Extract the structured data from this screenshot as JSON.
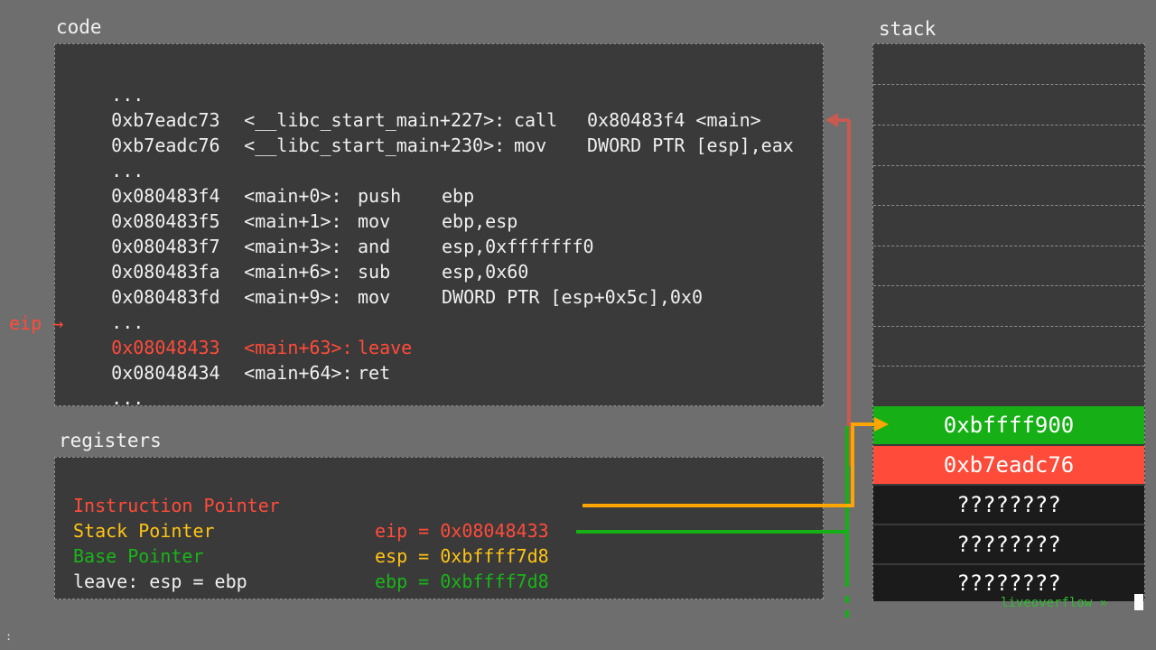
{
  "code": {
    "label": "code",
    "lines": [
      {
        "addr": "...",
        "sym": "",
        "op": "",
        "arg": ""
      },
      {
        "addr": "0xb7eadc73",
        "sym": "<__libc_start_main+227>:",
        "op": "call",
        "arg": "0x80483f4 <main>"
      },
      {
        "addr": "0xb7eadc76",
        "sym": "<__libc_start_main+230>:",
        "op": "mov",
        "arg": "DWORD PTR [esp],eax"
      },
      {
        "addr": "...",
        "sym": "",
        "op": "",
        "arg": ""
      },
      {
        "addr": "0x080483f4",
        "sym": "<main+0>:",
        "op": "push",
        "arg": "ebp"
      },
      {
        "addr": "0x080483f5",
        "sym": "<main+1>:",
        "op": "mov",
        "arg": "ebp,esp"
      },
      {
        "addr": "0x080483f7",
        "sym": "<main+3>:",
        "op": "and",
        "arg": "esp,0xfffffff0"
      },
      {
        "addr": "0x080483fa",
        "sym": "<main+6>:",
        "op": "sub",
        "arg": "esp,0x60"
      },
      {
        "addr": "0x080483fd",
        "sym": "<main+9>:",
        "op": "mov",
        "arg": "DWORD PTR [esp+0x5c],0x0"
      },
      {
        "addr": "...",
        "sym": "",
        "op": "",
        "arg": ""
      },
      {
        "addr": "0x08048433",
        "sym": "<main+63>:",
        "op": "leave",
        "arg": ""
      },
      {
        "addr": "0x08048434",
        "sym": "<main+64>:",
        "op": "ret",
        "arg": ""
      },
      {
        "addr": "...",
        "sym": "",
        "op": "",
        "arg": ""
      }
    ],
    "eip_marker": "eip →"
  },
  "registers": {
    "label": "registers",
    "eip": {
      "name": "Instruction Pointer",
      "value": "eip = 0x08048433"
    },
    "esp": {
      "name": "Stack Pointer",
      "value": "esp = 0xbffff7d8"
    },
    "ebp": {
      "name": "Base Pointer",
      "value": "ebp = 0xbffff7d8"
    },
    "note": "leave: esp = ebp"
  },
  "stack": {
    "label": "stack",
    "cells": [
      "0xbffff900",
      "0xb7eadc76",
      "????????",
      "????????",
      "????????"
    ]
  },
  "watermark": "liveoverflow »",
  "colors": {
    "background": "#6e6e6e",
    "panel": "#3a3a3a",
    "eip": "#ff4b3a",
    "esp": "#ffa500",
    "ebp": "#16b016",
    "stack_dark": "#1b1b1b"
  }
}
